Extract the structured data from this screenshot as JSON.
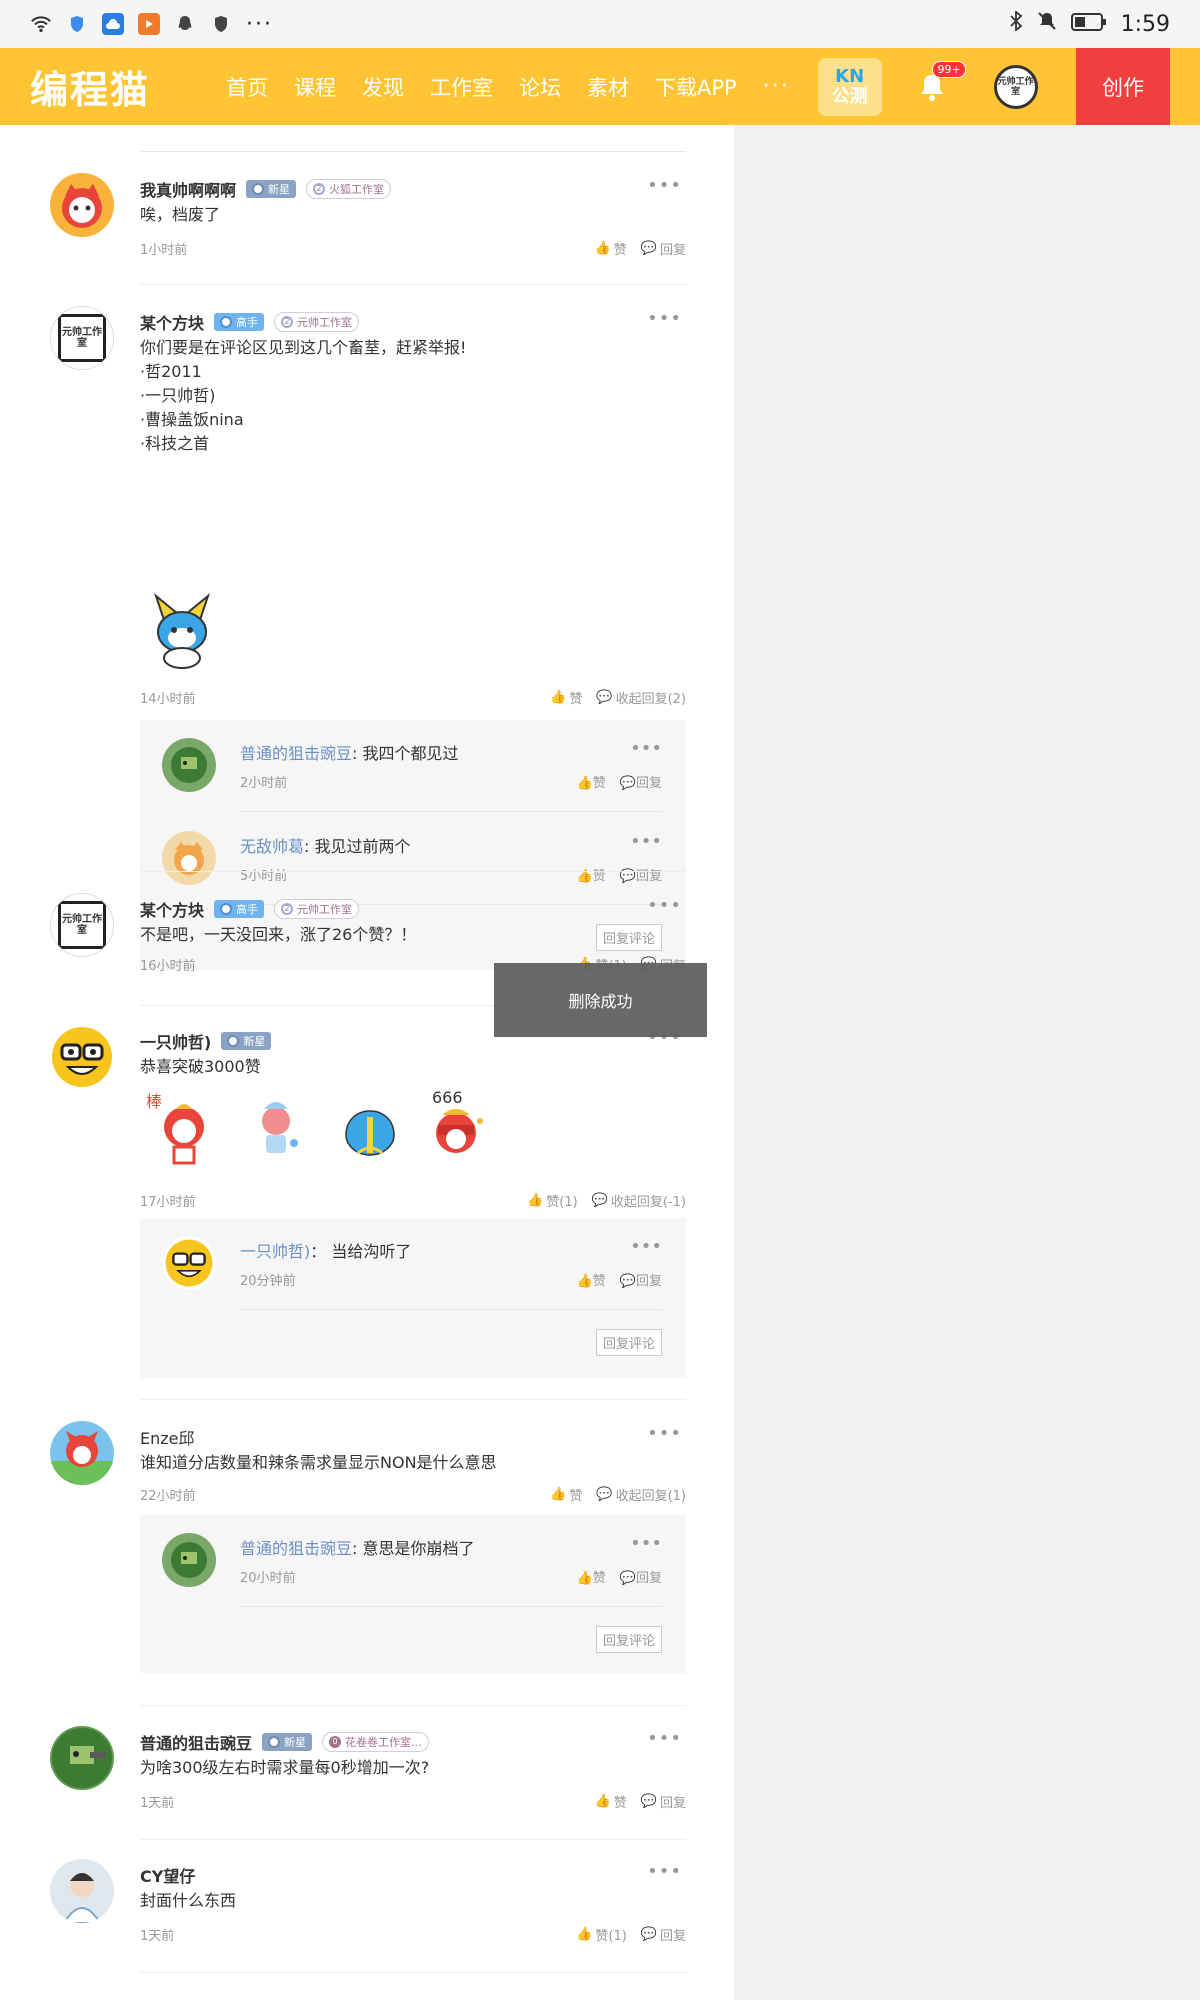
{
  "status": {
    "time": "1:59"
  },
  "nav": {
    "logo": "编程猫",
    "items": [
      "首页",
      "课程",
      "发现",
      "工作室",
      "论坛",
      "素材",
      "下载APP"
    ],
    "more": "···",
    "kn_top": "KN",
    "kn_bottom": "公测",
    "badge": "99+",
    "avatar_text": "元帅工作室",
    "create": "创作"
  },
  "comments": [
    {
      "name": "我真帅啊啊啊",
      "level": "新星",
      "studio": "火狐工作室",
      "text": "唉，档废了",
      "time": "1小时前",
      "like": "赞",
      "reply": "回复"
    },
    {
      "name": "某个方块",
      "level": "高手",
      "studio": "元帅工作室",
      "text": "你们要是在评论区见到这几个畜荎，赶紧举报!\n·哲2011\n·一只帅哲)\n·曹操盖饭nina\n·科技之首",
      "time": "14小时前",
      "like": "赞",
      "reply": "收起回复(2)",
      "replies": [
        {
          "user": "普通的狙击豌豆",
          "text": "我四个都见过",
          "time": "2小时前"
        },
        {
          "user": "无敌帅葛",
          "text": "我见过前两个",
          "time": "5小时前"
        }
      ]
    },
    {
      "name": "某个方块",
      "level": "高手",
      "studio": "元帅工作室",
      "text": "不是吧，一天没回来，涨了26个赞？！",
      "time": "16小时前",
      "like": "赞(1)",
      "reply": "回复"
    },
    {
      "name": "一只帅哲)",
      "level": "新星",
      "text": "恭喜突破3000赞",
      "time": "17小时前",
      "like": "赞(1)",
      "reply": "收起回复(-1)",
      "sticker_text": "666",
      "sticker_text2": "棒",
      "replies": [
        {
          "user": "一只帅哲)",
          "text": "当给沟听了",
          "time": "20分钟前"
        }
      ]
    },
    {
      "name": "Enze邱",
      "text": "谁知道分店数量和辣条需求量显示NON是什么意思",
      "time": "22小时前",
      "like": "赞",
      "reply": "收起回复(1)",
      "replies": [
        {
          "user": "普通的狙击豌豆",
          "text": "意思是你崩档了",
          "time": "20小时前"
        }
      ]
    },
    {
      "name": "普通的狙击豌豆",
      "level": "新星",
      "studio": "花卷卷工作室...",
      "studio_num": "0",
      "text": "为啥300级左右时需求量每0秒增加一次?",
      "time": "1天前",
      "like": "赞",
      "reply": "回复"
    },
    {
      "name": "CY望仔",
      "text": "封面什么东西",
      "time": "1天前",
      "like": "赞(1)",
      "reply": "回复"
    }
  ],
  "reply_like": "赞",
  "reply_reply": "回复",
  "reply_button": "回复评论",
  "studio_num": "2",
  "avatar_box_text": "元帅工作室",
  "toast": "删除成功",
  "colors": {
    "nav": "#fec433",
    "create": "#ef3f3f",
    "user_link": "#6a8fc6"
  }
}
